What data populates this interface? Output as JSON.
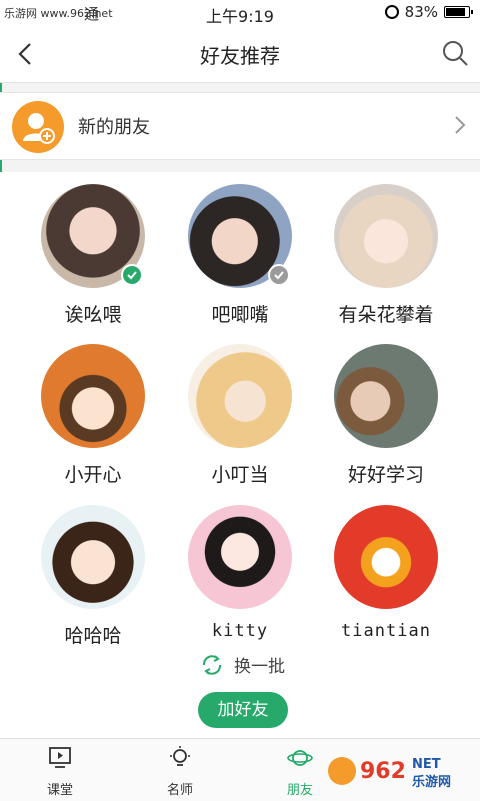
{
  "status_bar": {
    "watermark_text": "乐游网 www.962.net",
    "carrier": "通",
    "time": "上午9:19",
    "battery": "83%"
  },
  "nav": {
    "title": "好友推荐"
  },
  "new_friends": {
    "label": "新的朋友"
  },
  "friends": [
    {
      "name": "诶吆喂",
      "checked": true
    },
    {
      "name": "吧唧嘴",
      "checked": false
    },
    {
      "name": "有朵花攀着",
      "checked": null
    },
    {
      "name": "小开心",
      "checked": null
    },
    {
      "name": "小叮当",
      "checked": null
    },
    {
      "name": "好好学习",
      "checked": null
    },
    {
      "name": "哈哈哈",
      "checked": null
    },
    {
      "name": "kitty",
      "checked": null
    },
    {
      "name": "tiantian",
      "checked": null
    }
  ],
  "refresh_label": "换一批",
  "add_button_label": "加好友",
  "tabs": [
    {
      "label": "课堂",
      "icon": "play-screen-icon"
    },
    {
      "label": "名师",
      "icon": "lightbulb-icon"
    },
    {
      "label": "朋友",
      "icon": "planet-icon",
      "active": true
    }
  ],
  "watermark": "962 NET 乐游网",
  "colors": {
    "accent": "#27a96b",
    "orange": "#f49b2b"
  }
}
